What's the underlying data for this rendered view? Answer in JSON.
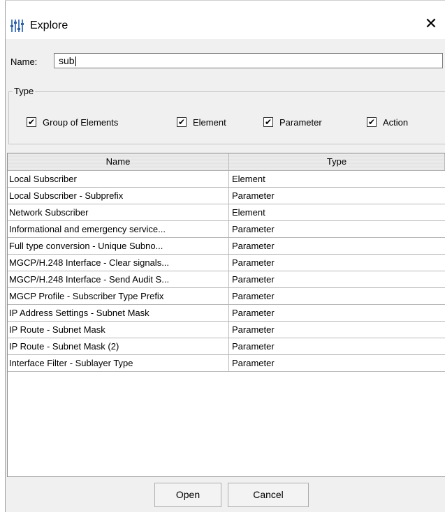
{
  "window": {
    "title": "Explore",
    "close_glyph": "✕",
    "icon": "explore-sliders-icon"
  },
  "search": {
    "label": "Name:",
    "value": "sub"
  },
  "type_filter": {
    "legend": "Type",
    "options": [
      {
        "label": "Group of Elements",
        "checked": true
      },
      {
        "label": "Element",
        "checked": true
      },
      {
        "label": "Parameter",
        "checked": true
      },
      {
        "label": "Action",
        "checked": true
      }
    ]
  },
  "table": {
    "columns": [
      "Name",
      "Type"
    ],
    "rows": [
      {
        "name": "Local Subscriber",
        "type": "Element"
      },
      {
        "name": "Local Subscriber - Subprefix",
        "type": "Parameter"
      },
      {
        "name": "Network Subscriber",
        "type": "Element"
      },
      {
        "name": "Informational and emergency service...",
        "type": "Parameter"
      },
      {
        "name": "Full type conversion - Unique Subno...",
        "type": "Parameter"
      },
      {
        "name": "MGCP/H.248 Interface - Clear signals...",
        "type": "Parameter"
      },
      {
        "name": "MGCP/H.248 Interface - Send Audit S...",
        "type": "Parameter"
      },
      {
        "name": "MGCP Profile - Subscriber Type Prefix",
        "type": "Parameter"
      },
      {
        "name": "IP Address Settings - Subnet Mask",
        "type": "Parameter"
      },
      {
        "name": "IP Route - Subnet Mask",
        "type": "Parameter"
      },
      {
        "name": "IP Route - Subnet Mask (2)",
        "type": "Parameter"
      },
      {
        "name": "Interface Filter - Sublayer Type",
        "type": "Parameter"
      }
    ]
  },
  "buttons": {
    "open": "Open",
    "cancel": "Cancel"
  }
}
